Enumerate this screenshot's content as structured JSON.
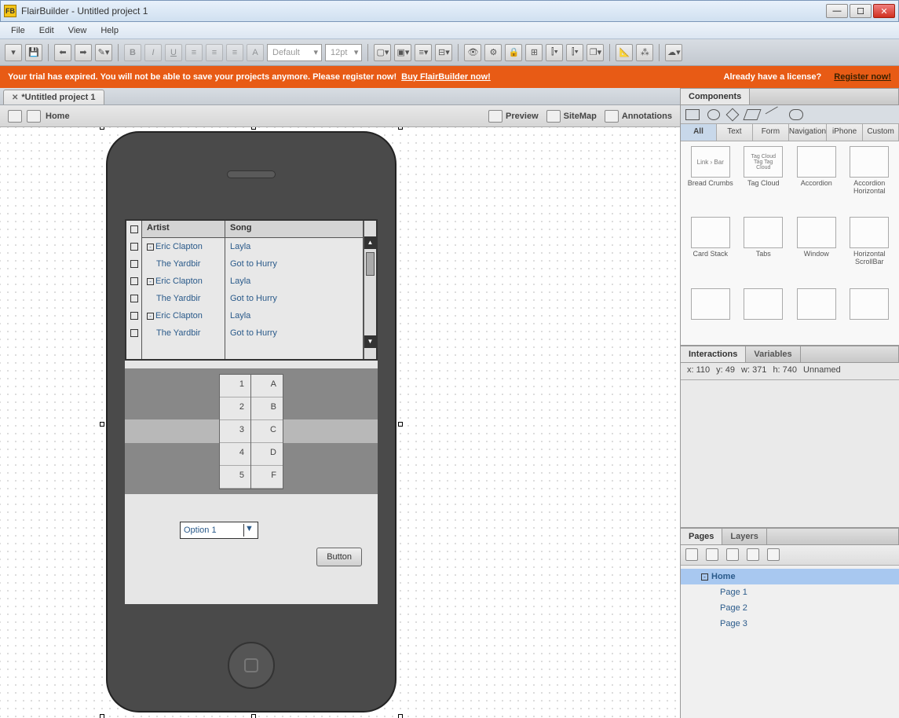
{
  "window": {
    "title": "FlairBuilder  - Untitled project 1",
    "app_icon_text": "FB"
  },
  "menu": {
    "items": [
      "File",
      "Edit",
      "View",
      "Help"
    ]
  },
  "toolbar": {
    "font_family": "Default",
    "font_size": "12pt"
  },
  "banner": {
    "text": "Your trial has expired. You will not be able to save your projects anymore. Please register now!",
    "buy_link": "Buy FlairBuilder now!",
    "license_q": "Already have a license?",
    "register": "Register now!"
  },
  "doc_tab": "*Untitled project 1",
  "canvasbar": {
    "home": "Home",
    "preview": "Preview",
    "sitemap": "SiteMap",
    "annotations": "Annotations"
  },
  "mockup": {
    "table": {
      "headers": [
        "Artist",
        "Song"
      ],
      "rows": [
        {
          "expand": "-",
          "artist": "Eric Clapton",
          "song": "Layla"
        },
        {
          "expand": "",
          "artist": "The Yardbir",
          "song": "Got to Hurry"
        },
        {
          "expand": "-",
          "artist": "Eric Clapton",
          "song": "Layla"
        },
        {
          "expand": "",
          "artist": "The Yardbir",
          "song": "Got to Hurry"
        },
        {
          "expand": "-",
          "artist": "Eric Clapton",
          "song": "Layla"
        },
        {
          "expand": "",
          "artist": "The Yardbir",
          "song": "Got to Hurry"
        }
      ]
    },
    "picker": {
      "col1": [
        "1",
        "2",
        "3",
        "4",
        "5"
      ],
      "col2": [
        "A",
        "B",
        "C",
        "D",
        "F"
      ]
    },
    "combo": "Option 1",
    "button": "Button"
  },
  "components": {
    "title": "Components",
    "filters": [
      "All",
      "Text",
      "Form",
      "Navigation",
      "iPhone",
      "Custom"
    ],
    "items": [
      {
        "label": "Bread Crumbs",
        "thumb": "Link › Bar"
      },
      {
        "label": "Tag Cloud",
        "thumb": "Tag Cloud Tag Tag Cloud"
      },
      {
        "label": "Accordion",
        "thumb": ""
      },
      {
        "label": "Accordion Horizontal",
        "thumb": ""
      },
      {
        "label": "Card Stack",
        "thumb": ""
      },
      {
        "label": "Tabs",
        "thumb": ""
      },
      {
        "label": "Window",
        "thumb": ""
      },
      {
        "label": "Horizontal ScrollBar",
        "thumb": ""
      },
      {
        "label": "",
        "thumb": ""
      },
      {
        "label": "",
        "thumb": ""
      },
      {
        "label": "",
        "thumb": ""
      },
      {
        "label": "",
        "thumb": ""
      }
    ]
  },
  "interactions": {
    "tab1": "Interactions",
    "tab2": "Variables",
    "props": {
      "x": "x: 110",
      "y": "y: 49",
      "w": "w: 371",
      "h": "h: 740",
      "name": "Unnamed"
    }
  },
  "pages": {
    "tab1": "Pages",
    "tab2": "Layers",
    "tree": [
      {
        "label": "Home",
        "sel": true,
        "exp": "-",
        "indent": 0
      },
      {
        "label": "Page 1",
        "sel": false,
        "exp": "",
        "indent": 1
      },
      {
        "label": "Page 2",
        "sel": false,
        "exp": "",
        "indent": 1
      },
      {
        "label": "Page 3",
        "sel": false,
        "exp": "",
        "indent": 1
      }
    ]
  }
}
